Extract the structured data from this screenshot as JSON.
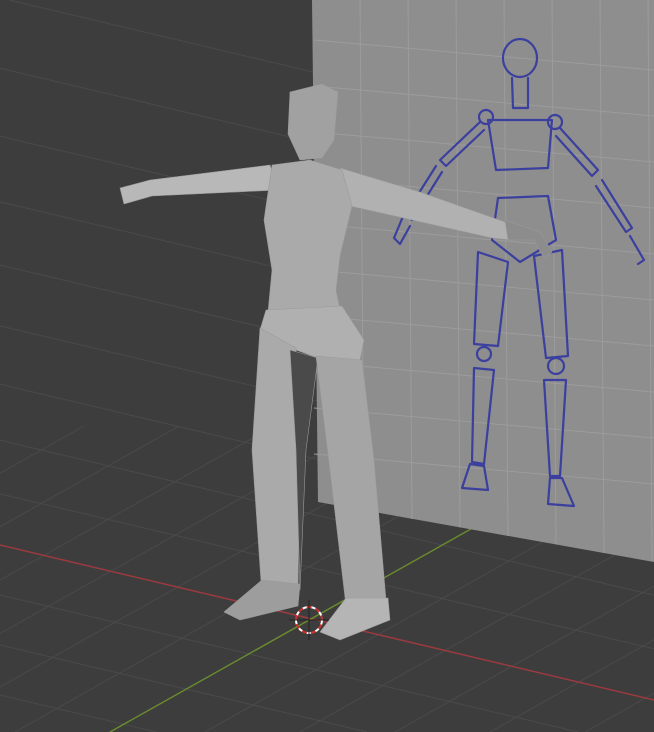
{
  "viewport": {
    "background_color": "#3d3d3d",
    "grid_color": "#4a4a4a",
    "x_axis_color": "#9b3a3f",
    "y_axis_color": "#6a8a2e",
    "reference_plane_color": "#8e8e8e",
    "reference_grid_color": "#9c9c9c",
    "sketch_color": "#3b3f9e",
    "mesh_color": "#a9aaa9"
  },
  "icons": {
    "cursor": "3d-cursor-icon"
  }
}
